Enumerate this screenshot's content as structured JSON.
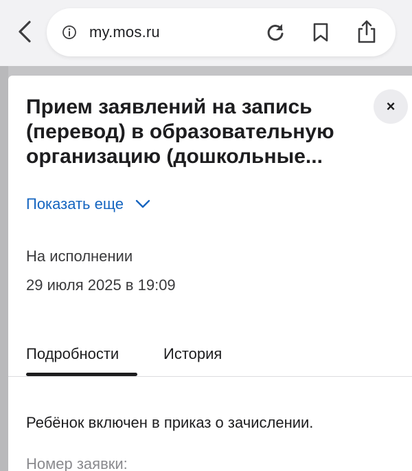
{
  "browser": {
    "url": "my.mos.ru",
    "icons": {
      "back": "chevron-left-icon",
      "info": "info-circle-icon",
      "reload": "reload-icon",
      "bookmark": "bookmark-icon",
      "share": "share-icon"
    }
  },
  "sheet": {
    "title": "Прием заявлений на запись (перевод) в образовательную организацию (дошкольные...",
    "close_label": "×",
    "show_more": "Показать еще",
    "status": "На исполнении",
    "date": "29 июля 2025 в 19:09",
    "tabs": [
      {
        "label": "Подробности",
        "active": true
      },
      {
        "label": "История",
        "active": false
      }
    ],
    "message": "Ребёнок включен в приказ о зачислении.",
    "field_label": "Номер заявки:"
  },
  "colors": {
    "link": "#1565c0",
    "backdrop": "#c4c4c6",
    "browser_bar": "#f2f2f4"
  }
}
